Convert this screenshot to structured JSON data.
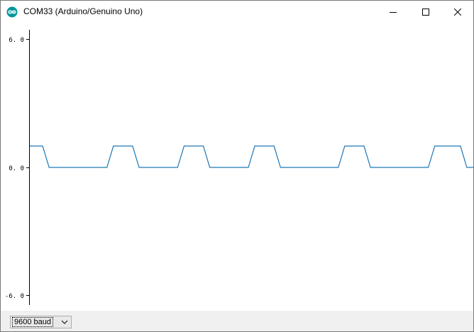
{
  "window": {
    "title": "COM33 (Arduino/Genuino Uno)",
    "icon": "arduino-logo-icon",
    "controls": [
      "minimize-icon",
      "maximize-icon",
      "close-icon"
    ]
  },
  "plot": {
    "y_ticks": [
      "6. 0",
      "0. 0",
      "-6. 0"
    ],
    "line_color": "#1f77b4",
    "axis_color": "#000000"
  },
  "bottom_bar": {
    "baud_rate": "9600 baud"
  },
  "chart_data": {
    "type": "line",
    "ylim": [
      -6,
      6
    ],
    "y_ticks": [
      6,
      0,
      -6
    ],
    "series": [
      {
        "values": [
          1,
          1,
          1,
          0,
          0,
          0,
          0,
          0,
          0,
          0,
          0,
          0,
          0,
          1,
          1,
          1,
          1,
          0,
          0,
          0,
          0,
          0,
          0,
          0,
          1,
          1,
          1,
          1,
          0,
          0,
          0,
          0,
          0,
          0,
          0,
          1,
          1,
          1,
          1,
          0,
          0,
          0,
          0,
          0,
          0,
          0,
          0,
          0,
          0,
          1,
          1,
          1,
          1,
          0,
          0,
          0,
          0,
          0,
          0,
          0,
          0,
          0,
          0,
          1,
          1,
          1,
          1,
          1,
          0,
          0
        ]
      }
    ]
  }
}
